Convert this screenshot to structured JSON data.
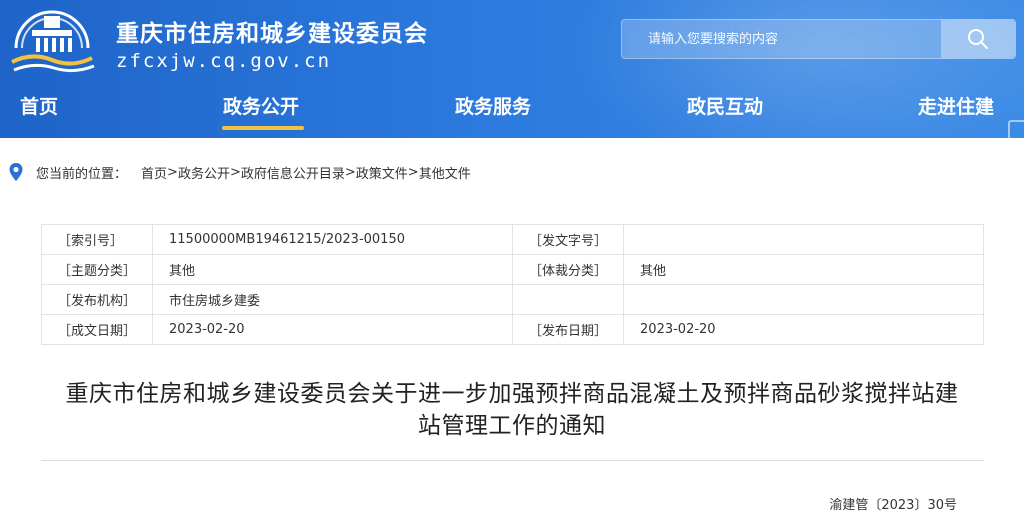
{
  "header": {
    "site_title": "重庆市住房和城乡建设委员会",
    "site_domain": "zfcxjw.cq.gov.cn",
    "logo_icon": "city-building-logo-icon",
    "background_color": "#2b79dd",
    "accent_color": "#f3c23f"
  },
  "search": {
    "placeholder": "请输入您要搜索的内容",
    "button_icon": "search-icon"
  },
  "nav": {
    "items": [
      {
        "label": "首页"
      },
      {
        "label": "政务公开"
      },
      {
        "label": "政务服务"
      },
      {
        "label": "政民互动"
      },
      {
        "label": "走进住建"
      }
    ],
    "active_index": 1
  },
  "breadcrumb": {
    "icon": "location-pin-icon",
    "prefix": "您当前的位置：",
    "items": [
      "首页",
      "政务公开",
      "政府信息公开目录",
      "政策文件",
      "其他文件"
    ],
    "separator": ">"
  },
  "info_table": {
    "rows": [
      [
        "［索引号］",
        "11500000MB19461215/2023-00150",
        "［发文字号］",
        ""
      ],
      [
        "［主题分类］",
        "其他",
        "［体裁分类］",
        "其他"
      ],
      [
        "［发布机构］",
        "市住房城乡建委",
        "",
        ""
      ],
      [
        "［成文日期］",
        "2023-02-20",
        "［发布日期］",
        "2023-02-20"
      ]
    ]
  },
  "document": {
    "title_line1": "重庆市住房和城乡建设委员会关于进一步加强预拌商品混凝土及预拌商品砂浆搅拌站建",
    "title_line2": "站管理工作的通知",
    "doc_number": "渝建管〔2023〕30号"
  }
}
